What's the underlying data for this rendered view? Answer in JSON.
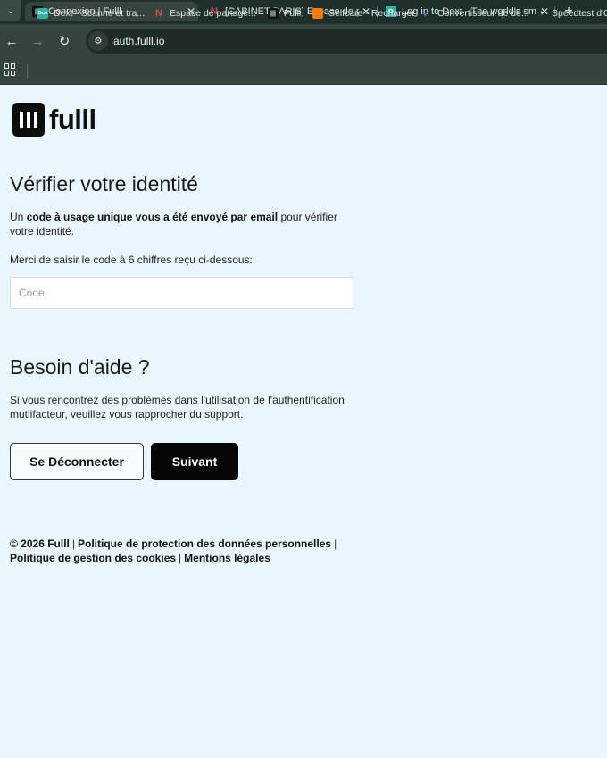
{
  "browser": {
    "tabs": [
      {
        "title": "Connexion | Fulll",
        "favicon": "fulll-icon",
        "active": true
      },
      {
        "title": "[CABINET PARIS] Espace de par",
        "favicon": "netexcom-icon",
        "active": false
      },
      {
        "title": "Log in to Dext - The world's sm",
        "favicon": "dext-icon",
        "active": false
      }
    ],
    "new_tab_label": "+",
    "url": "auth.fulll.io",
    "bookmarks": [
      {
        "label": "Dext - Scanne et tra...",
        "icon": "dext-icon",
        "icon_text": "Dext",
        "color": "#2bb3a3"
      },
      {
        "label": "Espace de partage...",
        "icon": "netexcom-icon",
        "icon_text": "N",
        "color": "#c0392b"
      },
      {
        "label": "Fulll",
        "icon": "fulll-icon",
        "icon_text": "",
        "color": "#111111"
      },
      {
        "label": "Selfcare - Recharger",
        "icon": "orange-icon",
        "icon_text": "",
        "color": "#ff7a00"
      },
      {
        "label": "Convertisseur de de...",
        "icon": "check-icon",
        "icon_text": "✓",
        "color": "#1d4fa8"
      },
      {
        "label": "Speedtest d'O",
        "icon": "speedtest-icon",
        "icon_text": "◔",
        "color": "#222222"
      }
    ]
  },
  "logo": {
    "text": "fulll"
  },
  "verify": {
    "title": "Vérifier votre identité",
    "intro_prefix": "Un ",
    "intro_bold": "code à usage unique vous a été envoyé par email",
    "intro_suffix": " pour vérifier votre identité.",
    "prompt": "Merci de saisir le code à 6 chiffres reçu ci-dessous:",
    "code_placeholder": "Code",
    "code_value": ""
  },
  "help": {
    "title": "Besoin d'aide ?",
    "text": "Si vous rencontrez des problèmes dans l'utilisation de l'authentification mutlifacteur, veuillez vous rapprocher du support."
  },
  "buttons": {
    "logout": "Se Déconnecter",
    "next": "Suivant"
  },
  "footer": {
    "copyright": "© 2026 Fulll",
    "links": [
      "Politique de protection des données personnelles",
      "Politique de gestion des cookies",
      "Mentions légales"
    ]
  },
  "colors": {
    "page_bg": "#eaf6fd",
    "primary_button": "#050505",
    "chrome_bg": "#35443f"
  }
}
